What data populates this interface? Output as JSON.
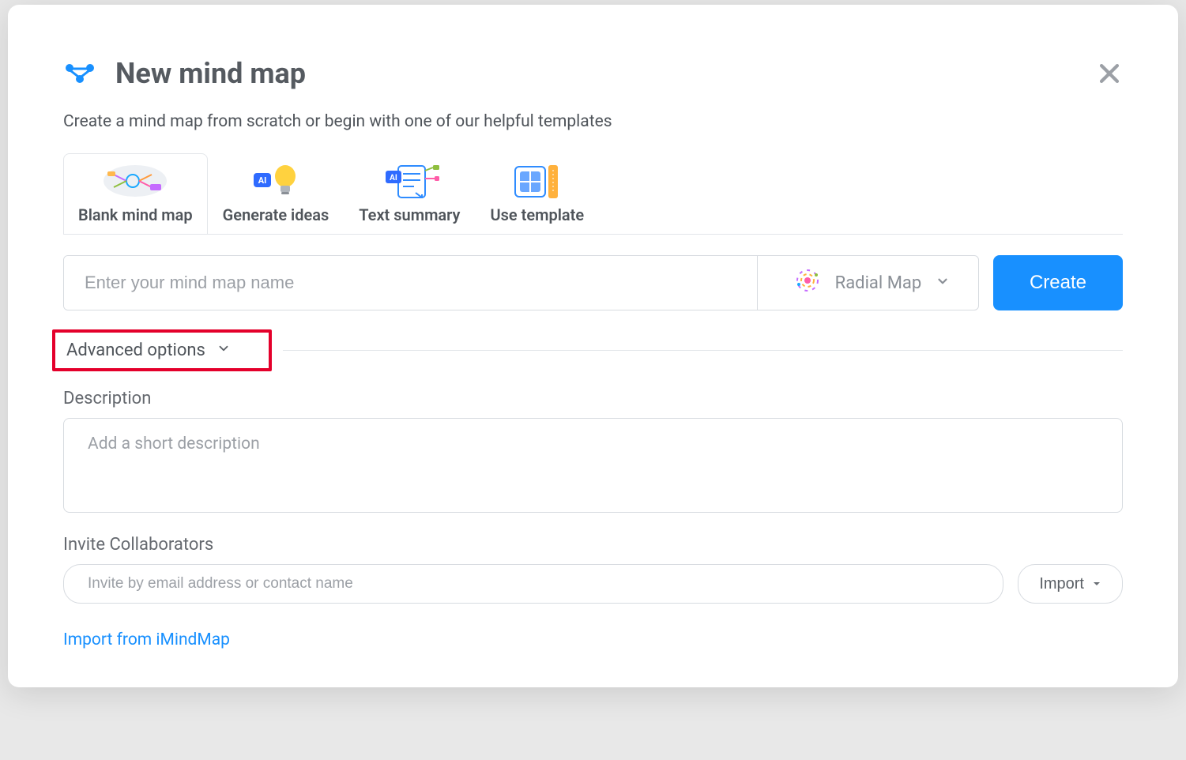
{
  "header": {
    "title": "New mind map",
    "subtitle": "Create a mind map from scratch or begin with one of our helpful templates"
  },
  "tabs": [
    {
      "label": "Blank mind map",
      "icon": "mindmap-icon"
    },
    {
      "label": "Generate ideas",
      "icon": "lightbulb-ai-icon"
    },
    {
      "label": "Text summary",
      "icon": "document-ai-icon"
    },
    {
      "label": "Use template",
      "icon": "template-icon"
    }
  ],
  "form": {
    "name_placeholder": "Enter your mind map name",
    "map_type_selected": "Radial Map",
    "create_label": "Create"
  },
  "advanced": {
    "toggle_label": "Advanced options"
  },
  "description": {
    "label": "Description",
    "placeholder": "Add a short description"
  },
  "collaborators": {
    "label": "Invite Collaborators",
    "placeholder": "Invite by email address or contact name",
    "import_label": "Import"
  },
  "footer": {
    "import_link": "Import from iMindMap"
  },
  "colors": {
    "primary": "#1890ff",
    "highlight_border": "#e4002b"
  }
}
